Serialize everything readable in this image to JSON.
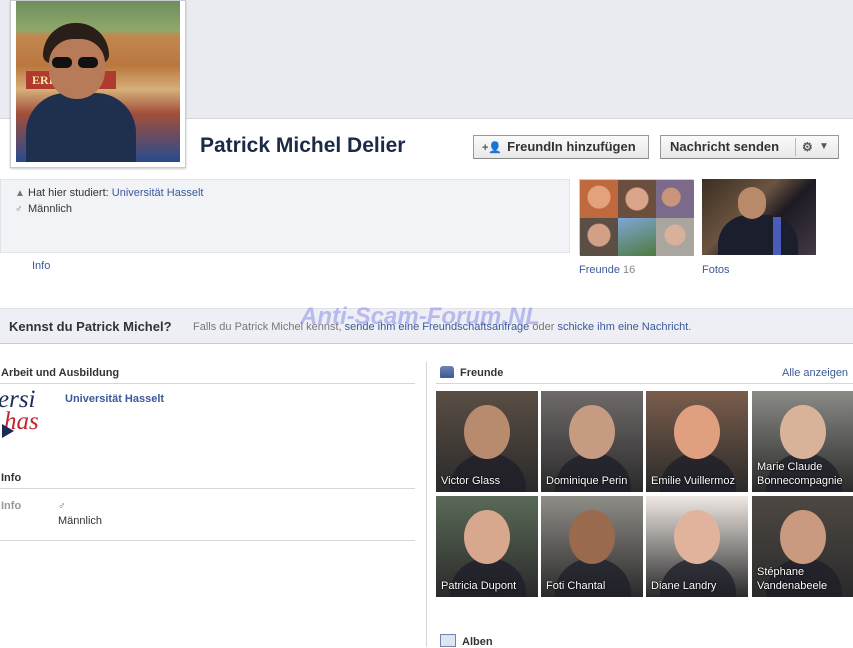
{
  "profile": {
    "name": "Patrick Michel Delier",
    "add_friend_label": "FreundIn hinzufügen",
    "message_label": "Nachricht senden",
    "studied_prefix": "Hat hier studiert: ",
    "studied_school": "Universität Hasselt",
    "gender": "Männlich",
    "info_link": "Info",
    "freunde_label": "Freunde",
    "freunde_count": "16",
    "fotos_label": "Fotos"
  },
  "kennst": {
    "title": "Kennst du Patrick Michel?",
    "desc_pre": "Falls du Patrick Michel kennst, ",
    "desc_link1": "sende ihm eine Freundschaftsanfrage",
    "desc_mid": " oder ",
    "desc_link2": "schicke ihm eine Nachricht",
    "desc_end": "."
  },
  "watermark": "Anti-Scam-Forum.NL",
  "left": {
    "work_title": "Arbeit und Ausbildung",
    "uni_logo_top": "ersi",
    "uni_logo_bottom": "has",
    "uni_name": "Universität Hasselt",
    "info_title": "Info",
    "info_label": "Info",
    "gender": "Männlich"
  },
  "friends": {
    "title": "Freunde",
    "see_all": "Alle anzeigen",
    "items": [
      {
        "name": "Victor Glass",
        "bg": "#5a4e44",
        "skin": "#b88a6e"
      },
      {
        "name": "Dominique Perin",
        "bg": "#6f6a6a",
        "skin": "#c79a82"
      },
      {
        "name": "Emilie Vuillermoz",
        "bg": "#7a5d4c",
        "skin": "#e0a07f"
      },
      {
        "name": "Marie Claude Bonnecompagnie",
        "bg": "#8a8a86",
        "skin": "#d8b39a"
      },
      {
        "name": "Patricia Dupont",
        "bg": "#5a6a57",
        "skin": "#d7a88d"
      },
      {
        "name": "Foti Chantal",
        "bg": "#8f8d87",
        "skin": "#9a6a4e"
      },
      {
        "name": "Diane Landry",
        "bg": "#efe9e4",
        "skin": "#e2b39c"
      },
      {
        "name": "Stéphane Vandenabeele",
        "bg": "#4e4843",
        "skin": "#c99a80"
      }
    ]
  },
  "albums_title": "Alben",
  "icons": {
    "school": "graduation-cap-icon",
    "gender": "male-symbol-icon",
    "add_friend": "add-friend-icon",
    "settings": "gear-icon",
    "dropdown": "chevron-down-icon",
    "friends": "friends-icon",
    "albums": "album-icon"
  }
}
